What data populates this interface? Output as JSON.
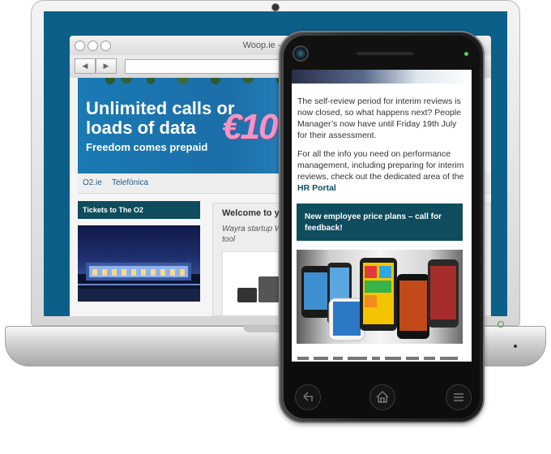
{
  "browser": {
    "title": "Woop.ie - Beautiful",
    "back_arrow": "◀",
    "forward_arrow": "▶"
  },
  "hero": {
    "headline": "Unlimited calls or loads of data",
    "subline": "Freedom comes prepaid",
    "price": "€10"
  },
  "subnav": {
    "items": [
      "O2.ie",
      "Telefónica"
    ]
  },
  "sidebar": {
    "heading": "Tickets to The O2"
  },
  "welcome": {
    "title": "Welcome to yo",
    "text": "Wayra startup W tool"
  },
  "phone_content": {
    "para1_a": "The self-review period for interim reviews is now closed, so what happens next? People Manager’s now have until Friday 19th July for their assessment.",
    "para2_a": "For all the info you need on performance management, including preparing for interim reviews, check out the dedicated area of the ",
    "para2_link": "HR Portal",
    "cta_text": "New employee price plans – call for feedback!"
  },
  "icons": [
    "back-icon",
    "home-icon",
    "menu-icon",
    "webcam-icon",
    "camera-icon"
  ]
}
